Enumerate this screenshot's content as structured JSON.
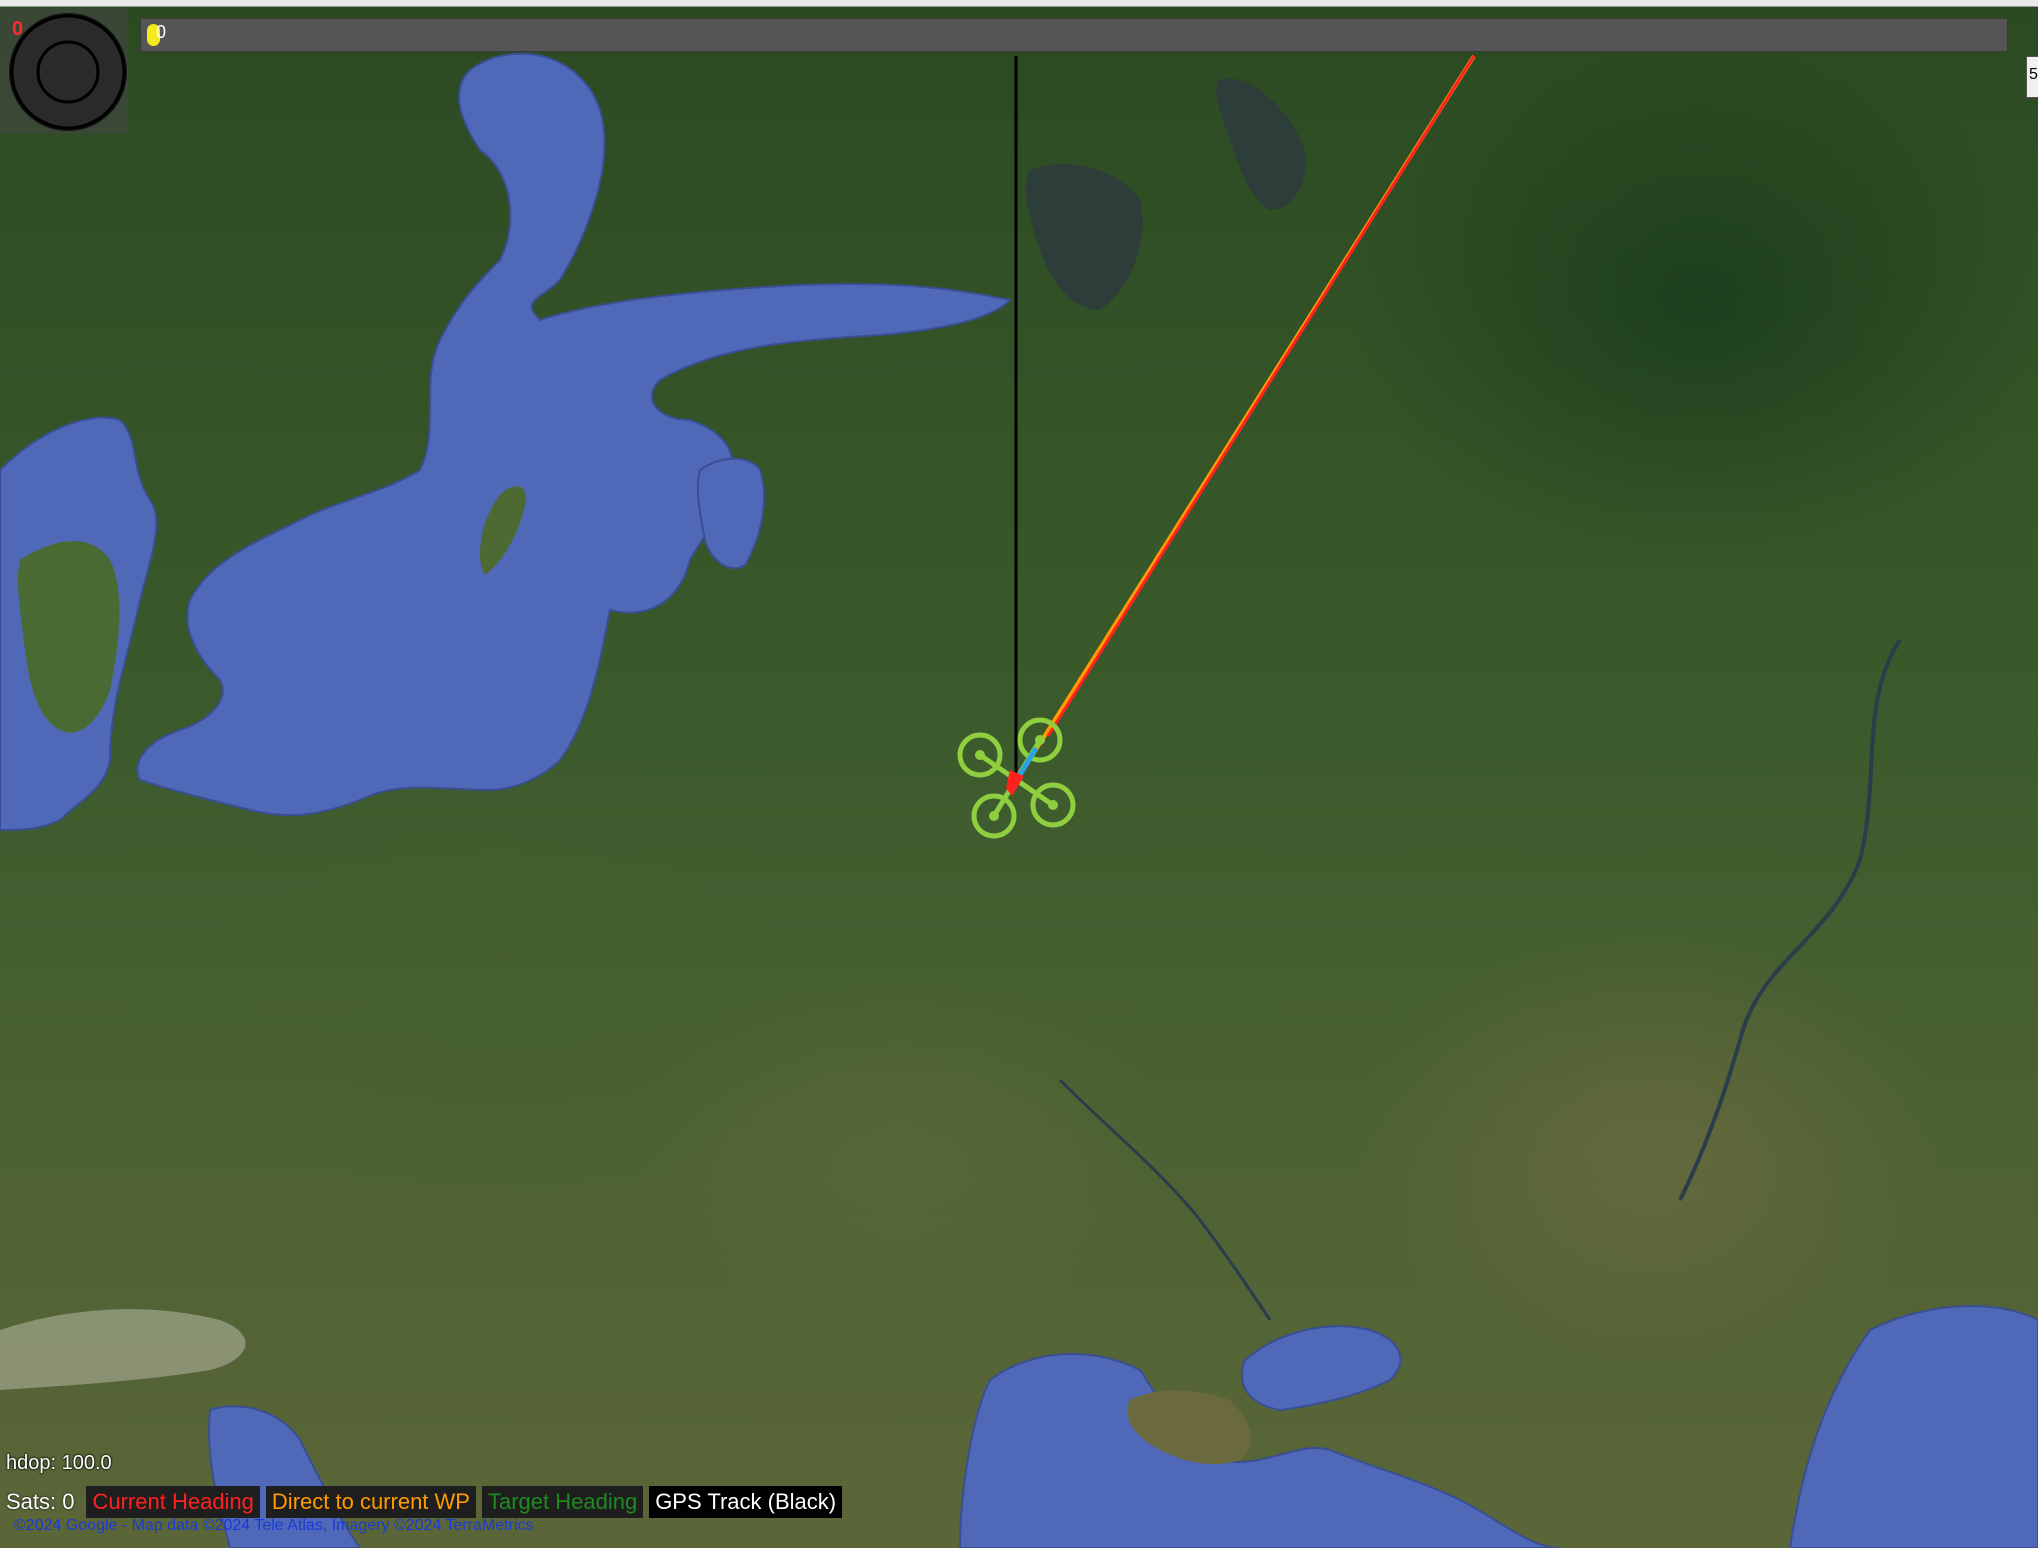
{
  "hud": {
    "compass_count": "0",
    "progress": {
      "value_label": "0"
    },
    "right_tab_label": "5",
    "hdop": "hdop: 100.0",
    "sats": "Sats: 0"
  },
  "legend": [
    {
      "label": "Current Heading",
      "color": "#ff2020"
    },
    {
      "label": "Direct to current WP",
      "color": "#ff9a00"
    },
    {
      "label": "Target Heading",
      "color": "#1f8a1f"
    },
    {
      "label": "GPS Track (Black)",
      "color": "#ffffff"
    }
  ],
  "copyright": "©2024 Google - Map data ©2024 Tele Atlas, Imagery ©2024 TerraMetrics",
  "colors": {
    "water": "#5068b8",
    "land": "#3a5a2b",
    "drone": "#8fcf3f",
    "heading_line": "#ff2020",
    "wp_line": "#ff9a00",
    "gps_track": "#000000",
    "target_heading": "#2aa3e6"
  }
}
